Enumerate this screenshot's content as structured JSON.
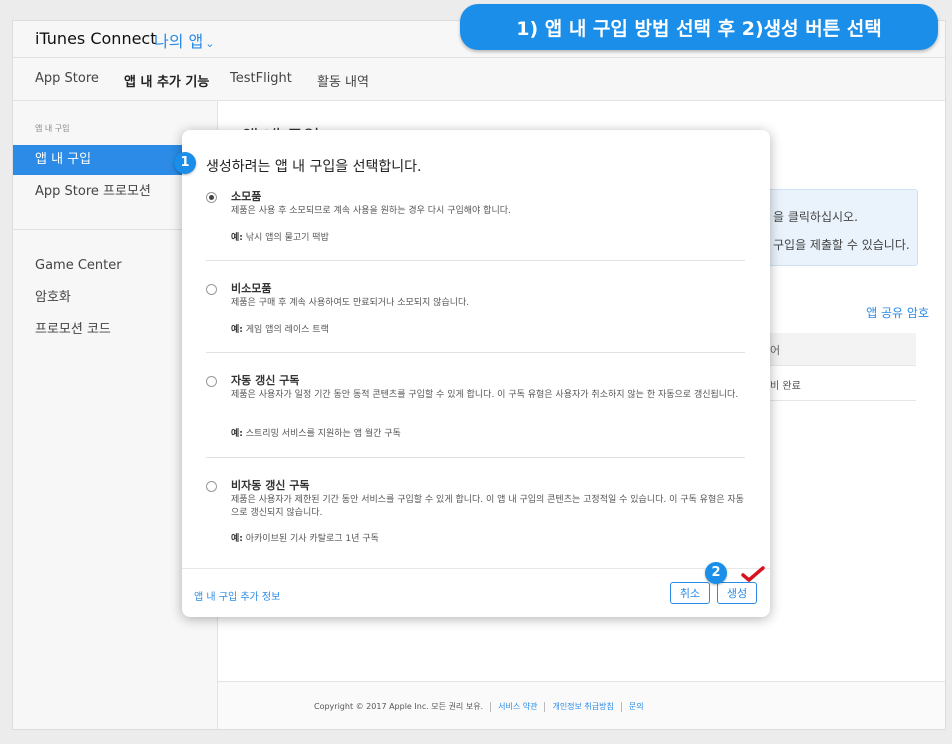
{
  "topbar": {
    "brand": "iTunes Connect",
    "app_menu": "나의 앱"
  },
  "callout": "1) 앱 내 구입 방법 선택 후 2)생성 버튼 선택",
  "tabs": [
    "App Store",
    "앱 내 추가 기능",
    "TestFlight",
    "활동 내역"
  ],
  "sidebar": {
    "section_header": "앱 내 구입",
    "items": [
      "앱 내 구입",
      "App Store 프로모션",
      "Game Center",
      "암호화",
      "프로모션 코드"
    ]
  },
  "page": {
    "title": "앱 내 구입",
    "info_line1": "을 클릭하십시오.",
    "info_line2": "구입을 제출할 수 있습니다.",
    "share_link": "앱 공유 암호",
    "table_header": "어",
    "table_row": "비 완료"
  },
  "modal": {
    "badge1": "1",
    "badge2": "2",
    "title": "생성하려는 앱 내 구입을 선택합니다.",
    "example_prefix": "예:",
    "options": [
      {
        "title": "소모품",
        "desc": "제품은 사용 후 소모되므로 계속 사용을 원하는 경우 다시 구입해야 합니다.",
        "example": " 낚시 앱의 물고기 떡밥",
        "selected": true
      },
      {
        "title": "비소모품",
        "desc": "제품은 구매 후 계속 사용하여도 만료되거나 소모되지 않습니다.",
        "example": " 게임 앱의 레이스 트랙",
        "selected": false
      },
      {
        "title": "자동 갱신 구독",
        "desc": "제품은 사용자가 일정 기간 동안 동적 콘텐츠를 구입할 수 있게 합니다. 이 구독 유형은 사용자가 취소하지 않는 한 자동으로 갱신됩니다.",
        "example": " 스트리밍 서비스를 지원하는 앱 월간 구독",
        "selected": false
      },
      {
        "title": "비자동 갱신 구독",
        "desc": "제품은 사용자가 제한된 기간 동안 서비스를 구입할 수 있게 합니다. 이 앱 내 구입의 콘텐츠는 고정적일 수 있습니다. 이 구독 유형은 자동으로 갱신되지 않습니다.",
        "example": " 아카이브된 기사 카탈로그 1년 구독",
        "selected": false
      }
    ],
    "more_info": "앱 내 구입 추가 정보",
    "cancel": "취소",
    "create": "생성"
  },
  "footer": {
    "copyright": "Copyright © 2017 Apple Inc. 모든 권리 보유.",
    "links": [
      "서비스 약관",
      "개인정보 취급방침",
      "문의"
    ]
  },
  "colors": {
    "accent": "#2b8be6",
    "callout": "#1a8ee8",
    "check": "#d9121f"
  }
}
